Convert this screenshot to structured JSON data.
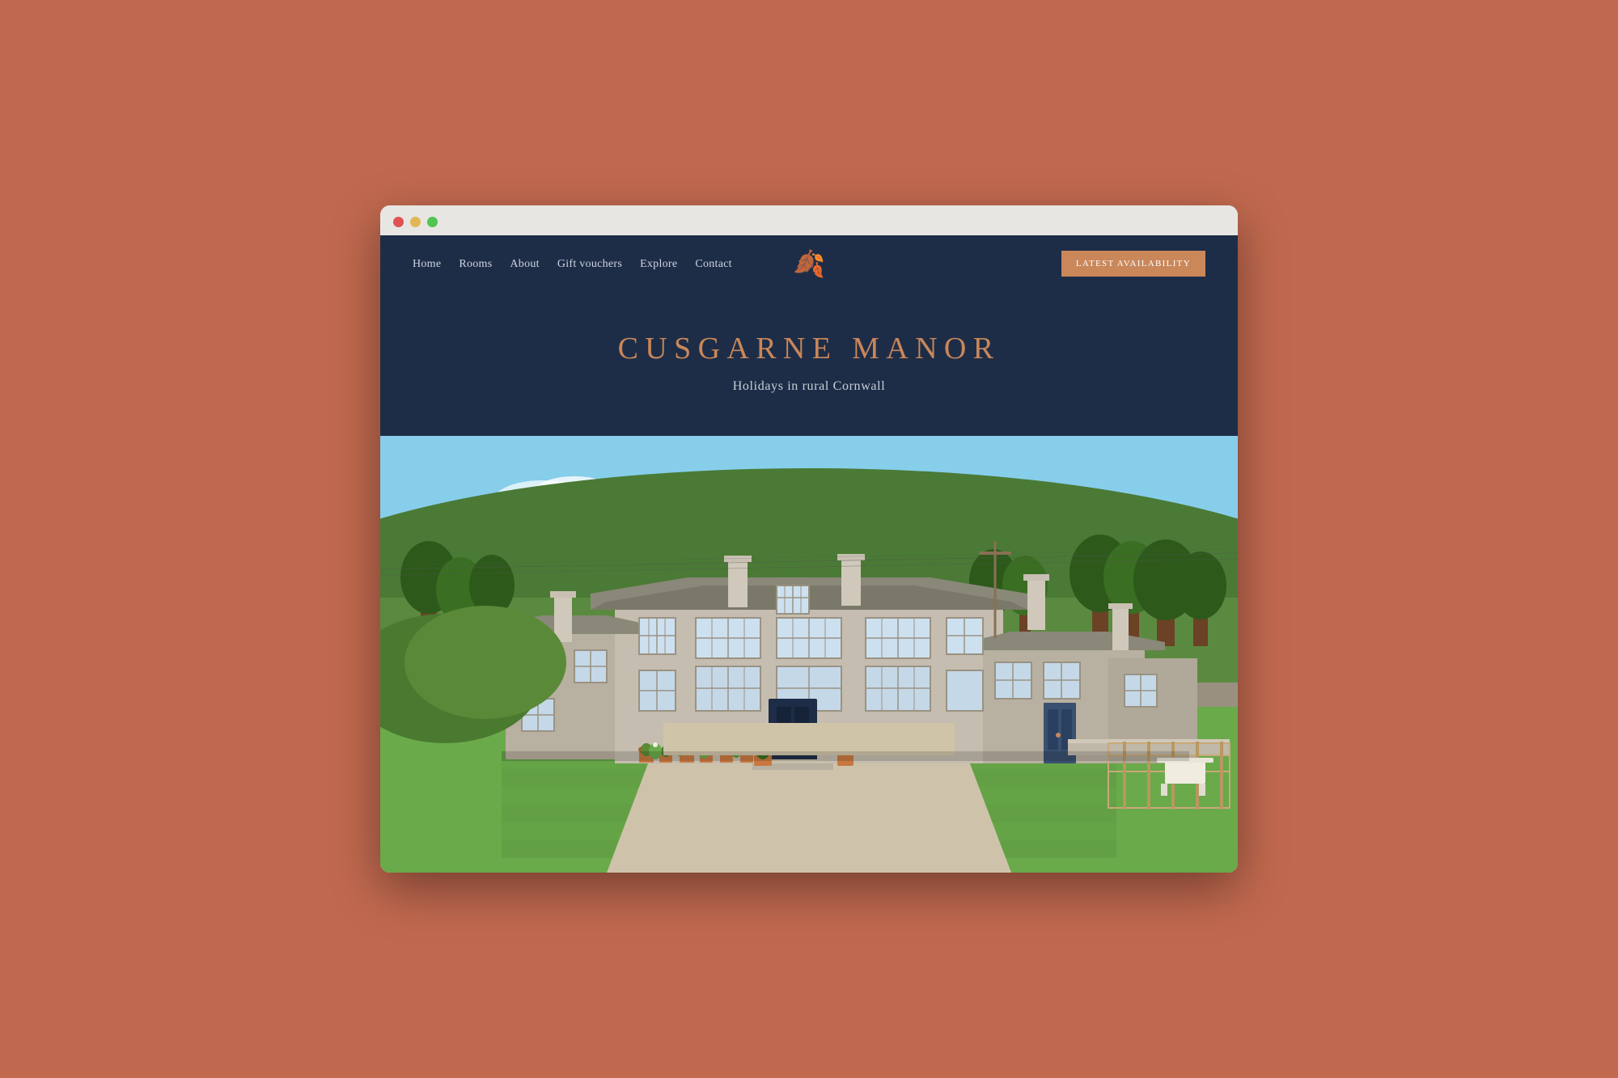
{
  "browser": {
    "traffic_lights": [
      "red",
      "yellow",
      "green"
    ]
  },
  "nav": {
    "links": [
      {
        "label": "Home",
        "href": "#"
      },
      {
        "label": "Rooms",
        "href": "#"
      },
      {
        "label": "About",
        "href": "#"
      },
      {
        "label": "Gift vouchers",
        "href": "#"
      },
      {
        "label": "Explore",
        "href": "#"
      },
      {
        "label": "Contact",
        "href": "#"
      }
    ]
  },
  "logo": {
    "icon": "🍂"
  },
  "cta": {
    "availability_label": "LATEST AVAILABILITY"
  },
  "hero": {
    "title": "CUSGARNE MANOR",
    "subtitle": "Holidays in rural Cornwall"
  },
  "colors": {
    "background": "#c1694f",
    "navy": "#1e2d47",
    "copper": "#c9875a",
    "browser_chrome": "#e8e6e3"
  }
}
